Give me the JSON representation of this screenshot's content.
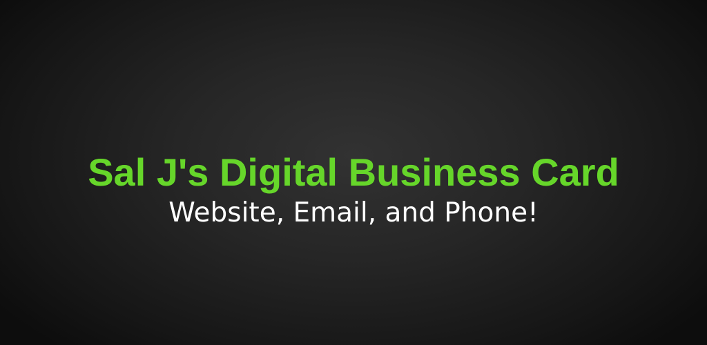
{
  "banner": {
    "title": "Sal J's Digital Business Card",
    "subtitle": "Website, Email, and Phone!"
  },
  "colors": {
    "title": "#66d62a",
    "subtitle": "#ffffff",
    "background_center": "#323232",
    "background_edge": "#0d0d0d"
  }
}
